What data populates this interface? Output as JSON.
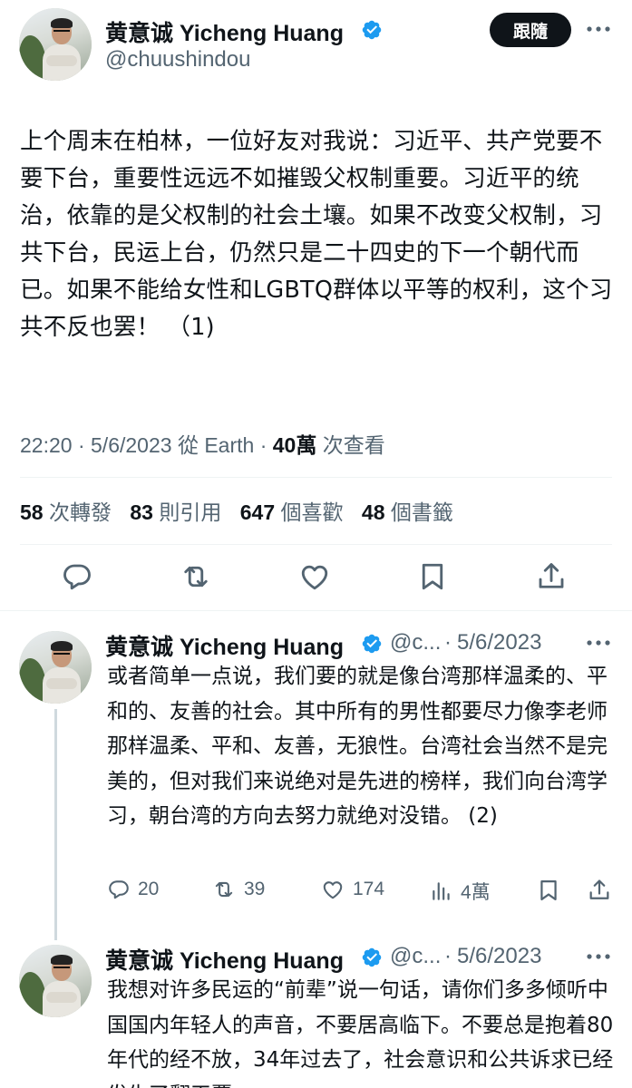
{
  "main_tweet": {
    "author_name": "黄意诚 Yicheng Huang",
    "handle": "@chuushindou",
    "follow_label": "跟隨",
    "text": "上个周末在柏林，一位好友对我说：习近平、共产党要不要下台，重要性远远不如摧毁父权制重要。习近平的统治，依靠的是父权制的社会土壤。如果不改变父权制，习共下台，民运上台，仍然只是二十四史的下一个朝代而已。如果不能给女性和LGBTQ群体以平等的权利，这个习共不反也罢！ （1)",
    "time": "22:20",
    "date": "5/6/2023",
    "source": "從 Earth",
    "views_count": "40萬",
    "views_label": "次查看",
    "stats": {
      "retweets": "58",
      "retweets_label": "次轉發",
      "quotes": "83",
      "quotes_label": "則引用",
      "likes": "647",
      "likes_label": "個喜歡",
      "bookmarks": "48",
      "bookmarks_label": "個書籤"
    }
  },
  "replies": [
    {
      "author_name": "黄意诚 Yicheng Huang",
      "handle": "@c...",
      "date": "5/6/2023",
      "text": "或者简单一点说，我们要的就是像台湾那样温柔的、平和的、友善的社会。其中所有的男性都要尽力像李老师那样温柔、平和、友善，无狼性。台湾社会当然不是完美的，但对我们来说绝对是先进的榜样，我们向台湾学习，朝台湾的方向去努力就绝对没错。 (2)",
      "replies": "20",
      "retweets": "39",
      "likes": "174",
      "views": "4萬"
    },
    {
      "author_name": "黄意诚 Yicheng Huang",
      "handle": "@c...",
      "date": "5/6/2023",
      "text": "我想对许多民运的“前辈”说一句话，请你们多多倾听中国国内年轻人的声音，不要居高临下。不要总是抱着80年代的经不放，34年过去了，社会意识和公共诉求已经发生了翻天覆"
    }
  ],
  "colors": {
    "text": "#0f1419",
    "secondary": "#536471",
    "verified": "#1d9bf0",
    "button": "#0f1419",
    "divider": "#eff3f4"
  },
  "icons": [
    "verified-badge-icon",
    "more-icon",
    "reply-icon",
    "retweet-icon",
    "like-icon",
    "bookmark-icon",
    "share-icon",
    "views-icon"
  ]
}
